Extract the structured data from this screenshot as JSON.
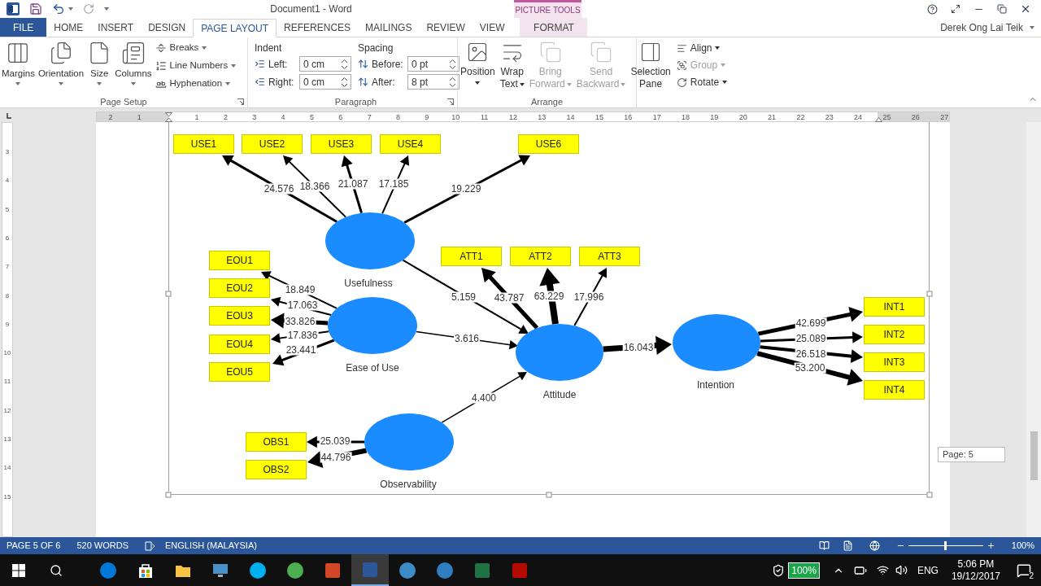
{
  "title_bar": {
    "title": "Document1 - Word",
    "contextual_group": "PICTURE TOOLS",
    "user": "Derek Ong Lai Teik"
  },
  "tabs": [
    {
      "label": "FILE",
      "kind": "file",
      "selected": false
    },
    {
      "label": "HOME",
      "kind": "plain",
      "selected": false
    },
    {
      "label": "INSERT",
      "kind": "plain",
      "selected": false
    },
    {
      "label": "DESIGN",
      "kind": "plain",
      "selected": false
    },
    {
      "label": "PAGE LAYOUT",
      "kind": "plain",
      "selected": true
    },
    {
      "label": "REFERENCES",
      "kind": "plain",
      "selected": false
    },
    {
      "label": "MAILINGS",
      "kind": "plain",
      "selected": false
    },
    {
      "label": "REVIEW",
      "kind": "plain",
      "selected": false
    },
    {
      "label": "VIEW",
      "kind": "plain",
      "selected": false
    },
    {
      "label": "FORMAT",
      "kind": "contextual",
      "selected": false
    }
  ],
  "page_setup": {
    "title": "Page Setup",
    "large_buttons": [
      "Margins",
      "Orientation",
      "Size",
      "Columns"
    ],
    "small_buttons": [
      "Breaks",
      "Line Numbers",
      "Hyphenation"
    ]
  },
  "paragraph": {
    "title": "Paragraph",
    "indent_label": "Indent",
    "spacing_label": "Spacing",
    "fields": [
      {
        "label": "Left:",
        "value": "0 cm"
      },
      {
        "label": "Right:",
        "value": "0 cm"
      },
      {
        "label": "Before:",
        "value": "0 pt"
      },
      {
        "label": "After:",
        "value": "8 pt"
      }
    ]
  },
  "arrange": {
    "title": "Arrange",
    "large_buttons": [
      {
        "lines": [
          "Position"
        ],
        "disabled": false
      },
      {
        "lines": [
          "Wrap",
          "Text"
        ],
        "disabled": false
      },
      {
        "lines": [
          "Bring",
          "Forward"
        ],
        "disabled": true
      },
      {
        "lines": [
          "Send",
          "Backward"
        ],
        "disabled": true
      },
      {
        "lines": [
          "Selection",
          "Pane"
        ],
        "disabled": false
      }
    ],
    "small_buttons": [
      {
        "label": "Align",
        "disabled": false
      },
      {
        "label": "Group",
        "disabled": true
      },
      {
        "label": "Rotate",
        "disabled": false
      }
    ]
  },
  "ruler": {
    "horizontal": [
      "2",
      "1",
      "1",
      "2",
      "3",
      "4",
      "5",
      "6",
      "7",
      "8",
      "9",
      "10",
      "11",
      "12",
      "13",
      "14",
      "15",
      "16",
      "17",
      "18",
      "19",
      "20",
      "21",
      "22",
      "23",
      "24",
      "25",
      "26",
      "27"
    ],
    "vertical": [
      "3",
      "4",
      "5",
      "6",
      "7",
      "8",
      "9",
      "10",
      "11",
      "12",
      "13",
      "14",
      "15"
    ]
  },
  "diagram": {
    "constructs": [
      {
        "name": "Usefulness",
        "indicators": [
          {
            "name": "USE1",
            "t_value": "24.576"
          },
          {
            "name": "USE2",
            "t_value": "18.366"
          },
          {
            "name": "USE3",
            "t_value": "21.087"
          },
          {
            "name": "USE4",
            "t_value": "17.185"
          },
          {
            "name": "USE6",
            "t_value": "19.229"
          }
        ]
      },
      {
        "name": "Ease of Use",
        "indicators": [
          {
            "name": "EOU1",
            "t_value": "18.849"
          },
          {
            "name": "EOU2",
            "t_value": "17.063"
          },
          {
            "name": "EOU3",
            "t_value": "33.826"
          },
          {
            "name": "EOU4",
            "t_value": "17.836"
          },
          {
            "name": "EOU5",
            "t_value": "23.441"
          }
        ]
      },
      {
        "name": "Attitude",
        "indicators": [
          {
            "name": "ATT1",
            "t_value": "43.787"
          },
          {
            "name": "ATT2",
            "t_value": "63.229"
          },
          {
            "name": "ATT3",
            "t_value": "17.996"
          }
        ]
      },
      {
        "name": "Intention",
        "indicators": [
          {
            "name": "INT1",
            "t_value": "42.699"
          },
          {
            "name": "INT2",
            "t_value": "25.089"
          },
          {
            "name": "INT3",
            "t_value": "26.518"
          },
          {
            "name": "INT4",
            "t_value": "53.200"
          }
        ]
      },
      {
        "name": "Observability",
        "indicators": [
          {
            "name": "OBS1",
            "t_value": "25.039"
          },
          {
            "name": "OBS2",
            "t_value": "44.796"
          }
        ]
      }
    ],
    "paths": [
      {
        "t_value": "5.159"
      },
      {
        "t_value": "3.616"
      },
      {
        "t_value": "4.400"
      },
      {
        "t_value": "16.043"
      }
    ]
  },
  "page_tooltip": "Page: 5",
  "status_bar": {
    "page": "PAGE 5 OF 6",
    "words": "520 WORDS",
    "language": "ENGLISH (MALAYSIA)",
    "zoom": "100%",
    "level": 0.5
  },
  "taskbar": {
    "battery": "100%",
    "language": "ENG",
    "time": "5:06 PM",
    "date": "19/12/2017",
    "notifications": "2"
  }
}
